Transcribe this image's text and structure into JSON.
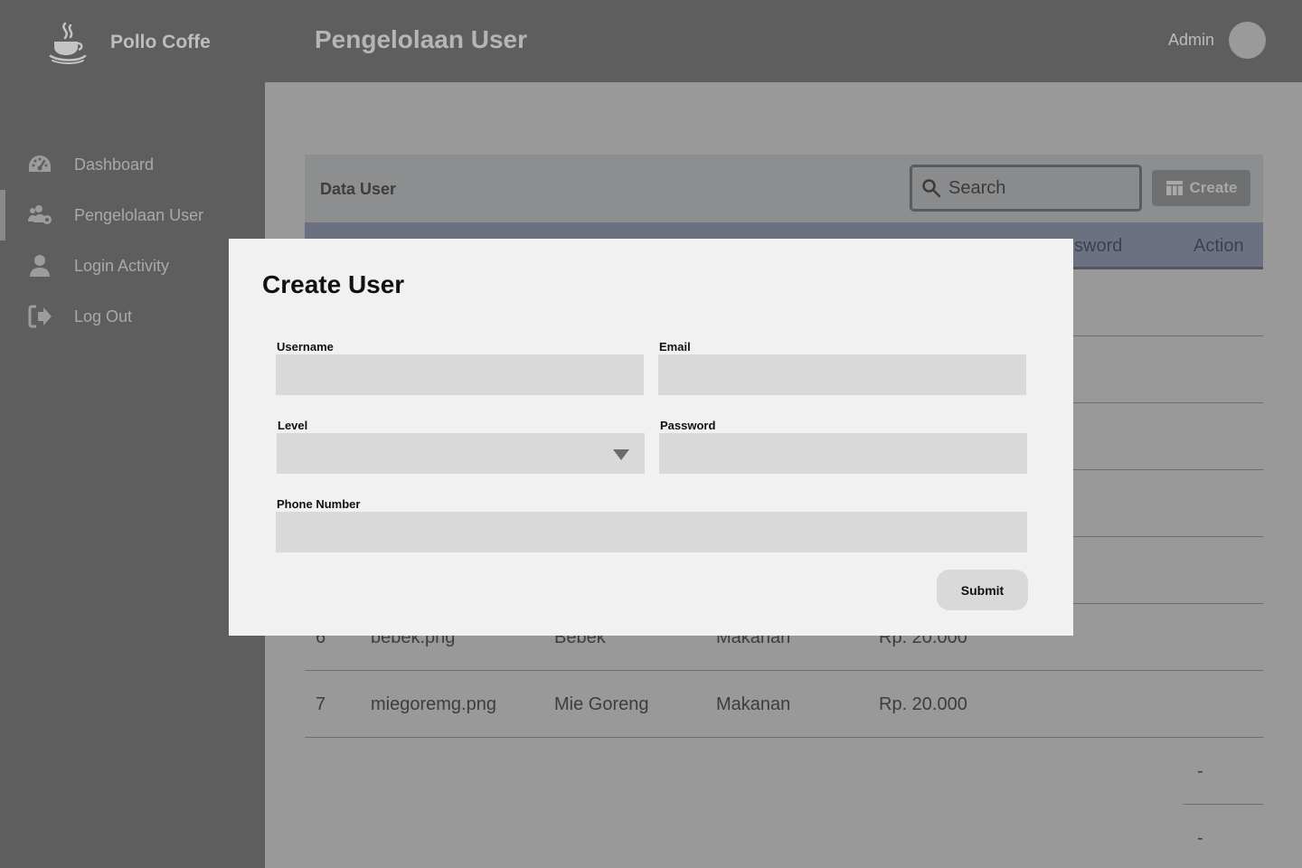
{
  "app": {
    "name": "Pollo Coffe",
    "logo_icon": "coffee-cup-icon"
  },
  "header": {
    "title": "Pengelolaan User",
    "user_name": "Admin"
  },
  "sidebar": {
    "items": [
      {
        "label": "Dashboard",
        "icon": "dashboard-gauge-icon"
      },
      {
        "label": "Pengelolaan User",
        "icon": "users-cog-icon",
        "active": true
      },
      {
        "label": "Login Activity",
        "icon": "user-icon"
      },
      {
        "label": "Log Out",
        "icon": "logout-icon"
      }
    ]
  },
  "card": {
    "title": "Data User",
    "search_placeholder": "Search",
    "create_label": "Create",
    "columns": {
      "password_partial": "sword",
      "action": "Action"
    },
    "rows": [
      {
        "no": "6",
        "image": "bebek.png",
        "name": "Bebek",
        "category": "Makanan",
        "price": "Rp. 20.000"
      },
      {
        "no": "7",
        "image": "miegoremg.png",
        "name": "Mie Goreng",
        "category": "Makanan",
        "price": "Rp. 20.000"
      }
    ],
    "extra_cells": [
      "-",
      "-"
    ]
  },
  "modal": {
    "title": "Create User",
    "fields": {
      "username": {
        "label": "Username",
        "value": ""
      },
      "email": {
        "label": "Email",
        "value": ""
      },
      "level": {
        "label": "Level",
        "value": ""
      },
      "password": {
        "label": "Password",
        "value": ""
      },
      "phone": {
        "label": "Phone Number",
        "value": ""
      }
    },
    "submit_label": "Submit"
  }
}
